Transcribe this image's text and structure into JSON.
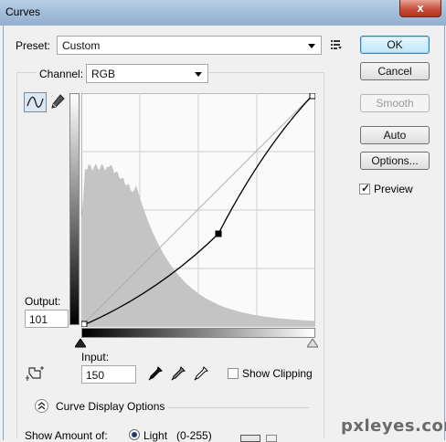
{
  "window": {
    "title": "Curves",
    "close_glyph": "x"
  },
  "preset": {
    "label": "Preset:",
    "value": "Custom",
    "menu_icon": "preset-options-icon"
  },
  "channel": {
    "label": "Channel:",
    "value": "RGB"
  },
  "buttons": {
    "ok": "OK",
    "cancel": "Cancel",
    "smooth": "Smooth",
    "auto": "Auto",
    "options": "Options..."
  },
  "preview": {
    "label": "Preview",
    "checked": true
  },
  "output": {
    "label": "Output:",
    "value": "101"
  },
  "input": {
    "label": "Input:",
    "value": "150"
  },
  "clipping": {
    "label": "Show Clipping",
    "checked": false
  },
  "display_options": {
    "label": "Curve Display Options"
  },
  "show_amount": {
    "label": "Show Amount of:",
    "light_label": "Light",
    "light_range": "(0-255)"
  },
  "tools": {
    "curve_tool": "curve-tool-icon",
    "pencil_tool": "pencil-tool-icon",
    "target_adjust": "target-adjust-icon",
    "eyedroppers": [
      "black-eyedropper-icon",
      "gray-eyedropper-icon",
      "white-eyedropper-icon"
    ]
  },
  "curve": {
    "input_range": [
      0,
      255
    ],
    "output_range": [
      0,
      255
    ],
    "points": [
      [
        0,
        0
      ],
      [
        150,
        101
      ],
      [
        255,
        255
      ]
    ]
  },
  "watermark": "pxleyes.com"
}
